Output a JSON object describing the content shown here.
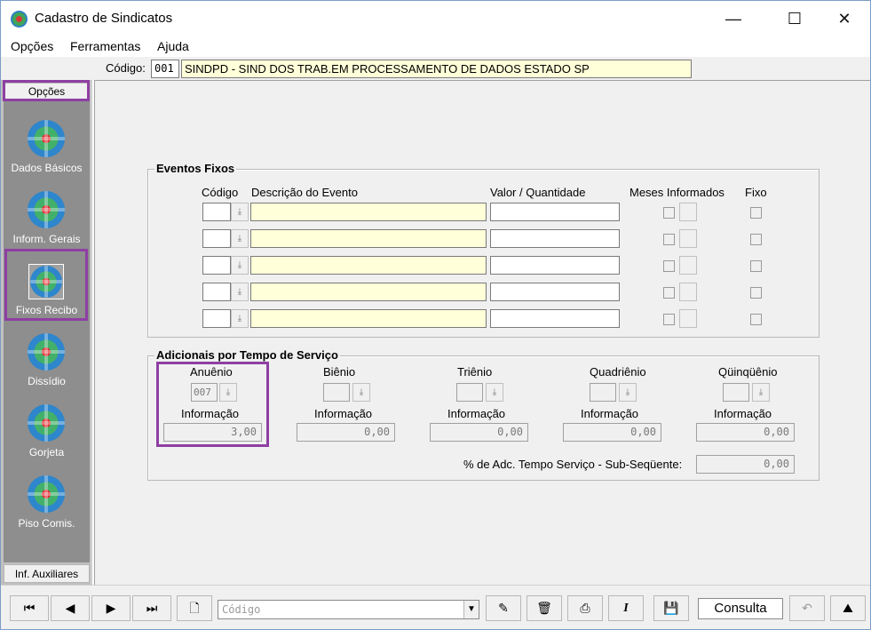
{
  "window": {
    "title": "Cadastro de Sindicatos",
    "controls": {
      "minimize": "—",
      "maximize": "☐",
      "close": "✕"
    }
  },
  "menu": {
    "items": [
      "Opções",
      "Ferramentas",
      "Ajuda"
    ]
  },
  "header": {
    "code_label": "Código:",
    "code_value": "001",
    "name_value": "SINDPD - SIND DOS TRAB.EM PROCESSAMENTO DE DADOS ESTADO SP"
  },
  "sidebar": {
    "top_button": "Opções",
    "bottom_button": "Inf. Auxiliares",
    "items": [
      {
        "label": "Dados Básicos",
        "icon": "app-logo-icon"
      },
      {
        "label": "Inform. Gerais",
        "icon": "app-logo-icon"
      },
      {
        "label": "Fixos Recibo",
        "icon": "app-logo-icon",
        "active": true
      },
      {
        "label": "Dissídio",
        "icon": "app-logo-icon"
      },
      {
        "label": "Gorjeta",
        "icon": "app-logo-icon"
      },
      {
        "label": "Piso Comis.",
        "icon": "app-logo-icon"
      }
    ]
  },
  "eventos_fixos": {
    "title": "Eventos Fixos",
    "headers": {
      "codigo": "Código",
      "descricao": "Descrição do Evento",
      "valor": "Valor / Quantidade",
      "meses": "Meses Informados",
      "fixo": "Fixo"
    },
    "rows": [
      {
        "codigo": "",
        "descricao": "",
        "valor": ""
      },
      {
        "codigo": "",
        "descricao": "",
        "valor": ""
      },
      {
        "codigo": "",
        "descricao": "",
        "valor": ""
      },
      {
        "codigo": "",
        "descricao": "",
        "valor": ""
      },
      {
        "codigo": "",
        "descricao": "",
        "valor": ""
      }
    ]
  },
  "adicionais": {
    "title": "Adicionais por Tempo de Serviço",
    "info_label": "Informação",
    "periods": [
      {
        "label": "Anuênio",
        "code": "007",
        "value": "3,00"
      },
      {
        "label": "Biênio",
        "code": "",
        "value": "0,00"
      },
      {
        "label": "Triênio",
        "code": "",
        "value": "0,00"
      },
      {
        "label": "Quadriênio",
        "code": "",
        "value": "0,00"
      },
      {
        "label": "Qüinqüênio",
        "code": "",
        "value": "0,00"
      }
    ],
    "subsequente_label": "% de Adc. Tempo Serviço - Sub-Seqüente:",
    "subsequente_value": "0,00"
  },
  "toolbar": {
    "combo_placeholder": "Código",
    "status": "Consulta"
  },
  "colors": {
    "highlight": "#8e3fa3",
    "input_yellow": "#ffffd9",
    "sidebar": "#8e8e8e"
  }
}
